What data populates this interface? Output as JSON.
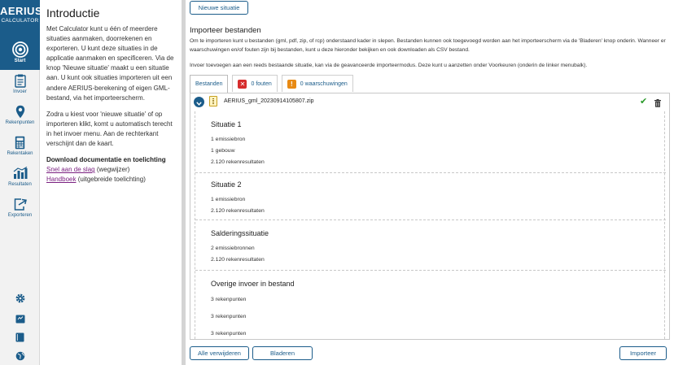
{
  "brand": {
    "name": "AERIUS",
    "sub": "CALCULATOR"
  },
  "nav": {
    "items": [
      {
        "label": "Start"
      },
      {
        "label": "Invoer"
      },
      {
        "label": "Rekenpunten"
      },
      {
        "label": "Rekentaken"
      },
      {
        "label": "Resultaten"
      },
      {
        "label": "Exporteren"
      }
    ]
  },
  "info": {
    "title": "Introductie",
    "p1": "Met Calculator kunt u één of meerdere situaties aanmaken, doorrekenen en exporteren. U kunt deze situaties in de applicatie aanmaken en specificeren. Via de knop 'Nieuwe situatie' maakt u een situatie aan. U kunt ook situaties importeren uit een andere AERIUS-berekening of eigen GML-bestand, via het importeerscherm.",
    "p2": "Zodra u kiest voor 'nieuwe situatie' of op importeren klikt, komt u automatisch terecht in het invoer menu. Aan de rechterkant verschijnt dan de kaart.",
    "download_title": "Download documentatie en toelichting",
    "link1": "Snel aan de slag",
    "link1_suffix": " (wegwijzer)",
    "link2": "Handboek",
    "link2_suffix": " (uitgebreide toelichting)"
  },
  "main": {
    "new_situation_button": "Nieuwe situatie",
    "import_title": "Importeer bestanden",
    "desc1": "Om te importeren kunt u bestanden (gml, pdf, zip, of rcp) onderstaand kader in slepen. Bestanden kunnen ook toegevoegd worden aan het importeerscherm via de 'Bladeren' knop onderin. Wanneer er waarschuwingen en/of fouten zijn bij bestanden, kunt u deze hieronder bekijken en ook downloaden als CSV bestand.",
    "desc2": "Invoer toevoegen aan een reeds bestaande situatie, kan via de geavanceerde importeermodus. Deze kunt u aanzetten onder Voorkeuren (onderin de linker menubalk).",
    "tabs": {
      "files": "Bestanden",
      "errors": "0 fouten",
      "warnings": "0 waarschuwingen"
    },
    "file": {
      "name": "AERIUS_gml_20230914105807.zip",
      "groups": [
        {
          "title": "Situatie 1",
          "lines": [
            "1 emissiebron",
            "1 gebouw",
            "2.120 rekenresultaten"
          ]
        },
        {
          "title": "Situatie 2",
          "lines": [
            "1 emissiebron",
            "2.120 rekenresultaten"
          ]
        },
        {
          "title": "Salderingssituatie",
          "lines": [
            "2 emissiebronnen",
            "2.120 rekenresultaten"
          ]
        },
        {
          "title": "Overige invoer in bestand",
          "lines": [
            "3 rekenpunten",
            "3 rekenpunten",
            "3 rekenpunten"
          ]
        }
      ]
    },
    "remove_all_button": "Alle verwijderen",
    "browse_button": "Bladeren",
    "import_button": "Importeer"
  }
}
